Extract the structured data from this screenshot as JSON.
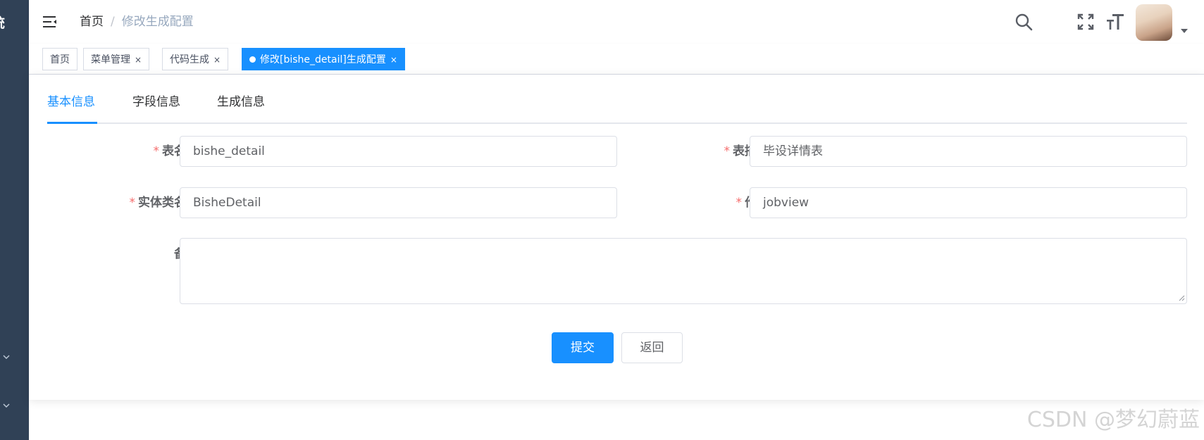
{
  "sidebar": {
    "logo_text": "统"
  },
  "navbar": {
    "breadcrumb": [
      {
        "label": "首页"
      },
      {
        "separator": "/"
      },
      {
        "label": "修改生成配置"
      }
    ],
    "icons": [
      "hamburger-icon",
      "search-icon",
      "fullscreen-icon",
      "font-size-icon",
      "avatar",
      "caret-down-icon"
    ]
  },
  "tags_view": {
    "tags": [
      {
        "label": "首页",
        "closable": false,
        "active": false
      },
      {
        "label": "菜单管理",
        "close": "×",
        "active": false
      },
      {
        "label": "代码生成",
        "close": "×",
        "active": false
      },
      {
        "label": "修改[bishe_detail]生成配置",
        "close": "×",
        "active": true
      }
    ]
  },
  "tabs": [
    {
      "label": "基本信息",
      "active": true
    },
    {
      "label": "字段信息",
      "active": false
    },
    {
      "label": "生成信息",
      "active": false
    }
  ],
  "form": {
    "required_mark": "*",
    "table_name": {
      "label": "表名称",
      "value": "bishe_detail"
    },
    "table_comment": {
      "label": "表描述",
      "value": "毕设详情表"
    },
    "class_name": {
      "label": "实体类名称",
      "value": "BisheDetail"
    },
    "author": {
      "label": "作者",
      "value": "jobview"
    },
    "remark": {
      "label": "备注",
      "value": ""
    }
  },
  "actions": {
    "submit": "提交",
    "back": "返回"
  },
  "watermark": "CSDN @梦幻蔚蓝",
  "colors": {
    "sidebar": "#304156",
    "primary": "#1890ff",
    "required": "#f56c6c",
    "border": "#dcdfe6"
  }
}
